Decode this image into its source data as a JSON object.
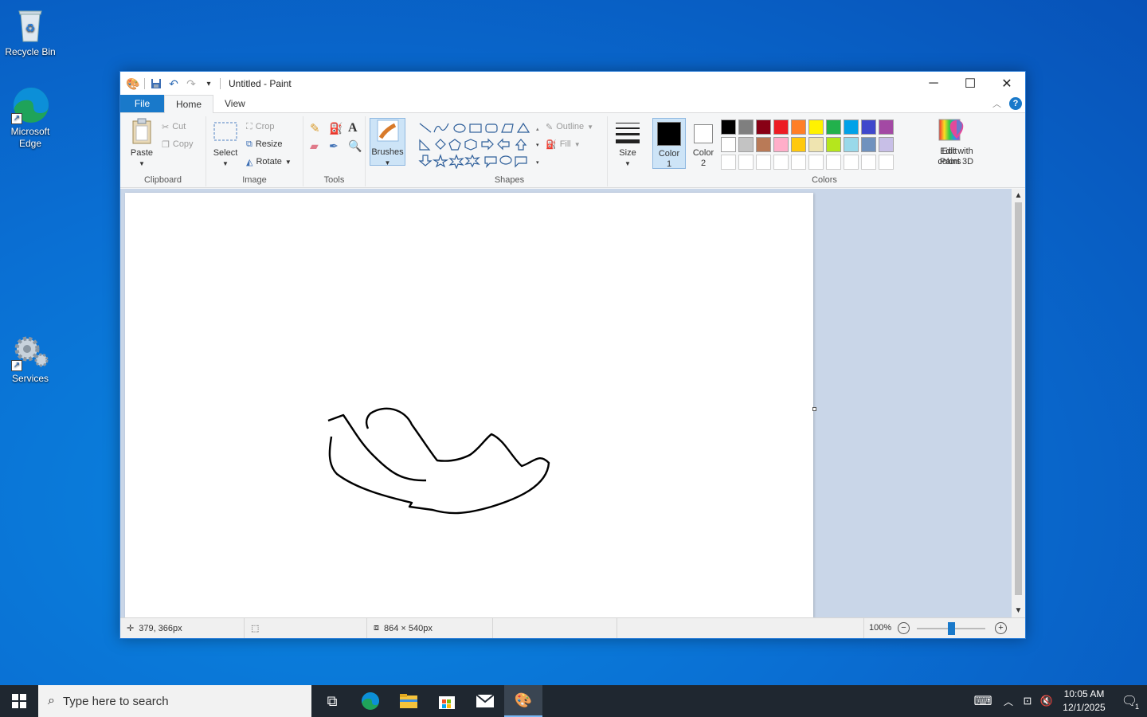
{
  "desktop": {
    "icons": [
      {
        "label": "Recycle Bin"
      },
      {
        "label": "Microsoft Edge"
      },
      {
        "label": "Services"
      }
    ]
  },
  "window": {
    "title": "Untitled - Paint",
    "tabs": {
      "file": "File",
      "home": "Home",
      "view": "View"
    },
    "help": "?",
    "ribbon": {
      "clipboard": {
        "paste": "Paste",
        "cut": "Cut",
        "copy": "Copy",
        "group": "Clipboard"
      },
      "image": {
        "select": "Select",
        "crop": "Crop",
        "resize": "Resize",
        "rotate": "Rotate",
        "group": "Image"
      },
      "tools": {
        "group": "Tools"
      },
      "brushes": {
        "label": "Brushes"
      },
      "shapes": {
        "outline": "Outline",
        "fill": "Fill",
        "group": "Shapes"
      },
      "size": {
        "label": "Size"
      },
      "colors": {
        "color1": "Color",
        "color1_num": "1",
        "color2": "Color",
        "color2_num": "2",
        "edit": "Edit",
        "edit2": "colors",
        "paint3d": "Edit with",
        "paint3d2": "Paint 3D",
        "group": "Colors",
        "color1_value": "#000000",
        "color2_value": "#ffffff",
        "row1": [
          "#000000",
          "#7f7f7f",
          "#880015",
          "#ed1c24",
          "#ff7f27",
          "#fff200",
          "#22b14c",
          "#00a2e8",
          "#3f48cc",
          "#a349a4"
        ],
        "row2": [
          "#ffffff",
          "#c3c3c3",
          "#b97a57",
          "#ffaec9",
          "#ffc90e",
          "#efe4b0",
          "#b5e61d",
          "#99d9ea",
          "#7092be",
          "#c8bfe7"
        ]
      }
    },
    "status": {
      "cursor": "379, 366px",
      "canvas_size": "864 × 540px",
      "zoom": "100%",
      "zoom_level": 0.5
    }
  },
  "taskbar": {
    "search_placeholder": "Type here to search",
    "time": "10:05 AM",
    "date": "12/1/2025",
    "notifications": "1"
  }
}
